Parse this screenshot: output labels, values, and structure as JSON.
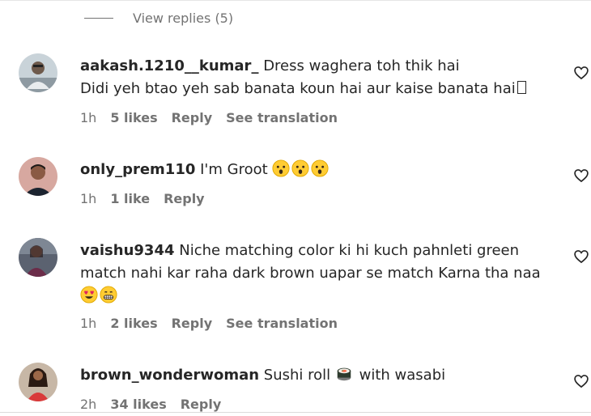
{
  "view_replies": {
    "label": "View replies (5)"
  },
  "comments": [
    {
      "username": "aakash.1210__kumar_",
      "text_line1": "Dress waghera toh thik hai",
      "text_line2": "Didi yeh btao yeh sab banata koun hai aur kaise banata hai",
      "time": "1h",
      "likes": "5 likes",
      "reply": "Reply",
      "translation": "See translation"
    },
    {
      "username": "only_prem110",
      "text": "I'm Groot",
      "emojis": [
        "hushed-face-emoji",
        "hushed-face-emoji",
        "hushed-face-emoji"
      ],
      "time": "1h",
      "likes": "1 like",
      "reply": "Reply"
    },
    {
      "username": "vaishu9344",
      "text_line1": "Niche matching color ki hi kuch pahnleti green",
      "text_line2": "match nahi kar raha dark brown uapar se match Karna tha naa",
      "emojis": [
        "heart-eyes-emoji",
        "grimacing-face-emoji"
      ],
      "time": "1h",
      "likes": "2 likes",
      "reply": "Reply",
      "translation": "See translation"
    },
    {
      "username": "brown_wonderwoman",
      "text_before": "Sushi roll",
      "text_after": "with wasabi",
      "emojis": [
        "sushi-emoji"
      ],
      "time": "2h",
      "likes": "34 likes",
      "reply": "Reply"
    }
  ],
  "colors": {
    "text": "#262626",
    "muted": "#737373",
    "background": "#ffffff"
  },
  "icons": {
    "like": "heart-outline-icon"
  }
}
